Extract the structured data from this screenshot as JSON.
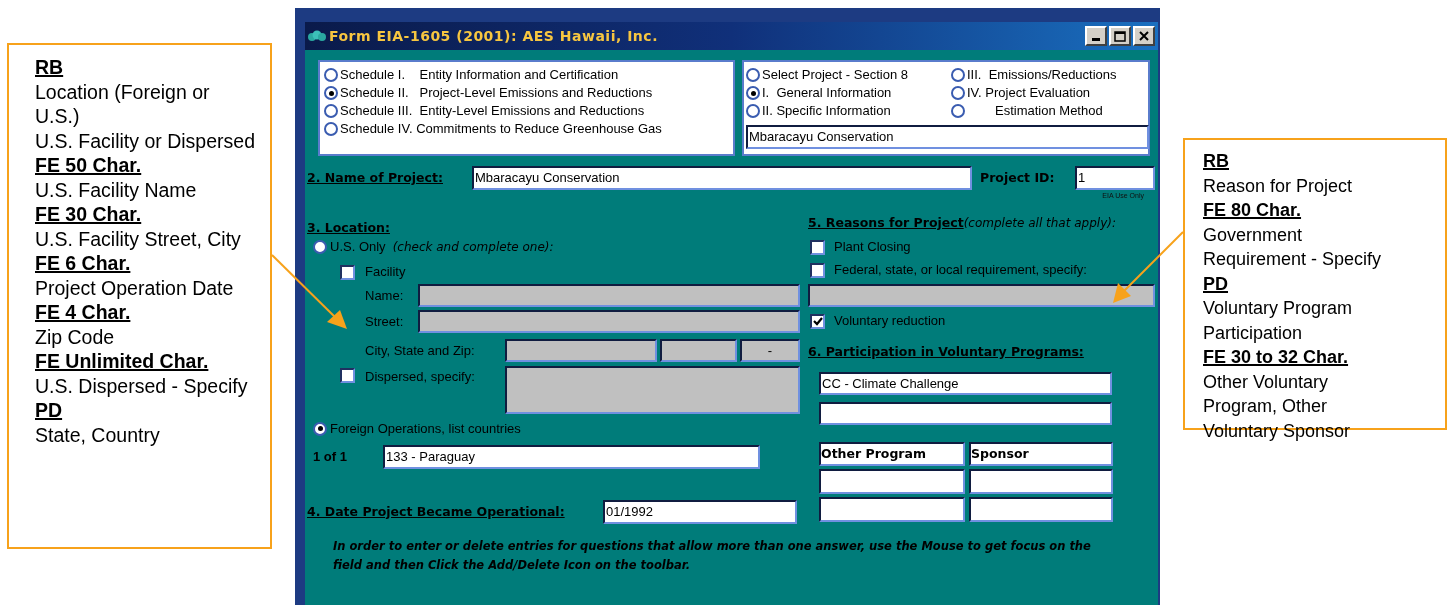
{
  "window": {
    "title": "Form EIA-1605 (2001): AES Hawaii, Inc."
  },
  "schedules": [
    {
      "label": "Schedule I.    Entity Information and Certification",
      "selected": false
    },
    {
      "label": "Schedule II.   Project-Level Emissions and Reductions",
      "selected": true
    },
    {
      "label": "Schedule III.  Entity-Level Emissions and Reductions",
      "selected": false
    },
    {
      "label": "Schedule IV. Commitments to Reduce Greenhouse Gas",
      "selected": false
    }
  ],
  "sections": [
    {
      "label": "Select Project - Section 8",
      "selected": false
    },
    {
      "label": "I.  General Information",
      "selected": true
    },
    {
      "label": "II. Specific Information",
      "selected": false
    },
    {
      "label": "III.  Emissions/Reductions",
      "selected": false
    },
    {
      "label": "IV. Project Evaluation",
      "selected": false
    },
    {
      "label": "Estimation Method",
      "selected": false
    }
  ],
  "section_project": {
    "value": "Mbaracayu Conservation"
  },
  "project_name": {
    "label": "2. Name of Project:",
    "value": "Mbaracayu Conservation"
  },
  "project_id": {
    "label": "Project ID:",
    "value": "1",
    "note": "EIA Use Only"
  },
  "location": {
    "heading": "3. Location:",
    "us_only": {
      "label": "U.S. Only",
      "hint": "(check and complete one):",
      "selected": false
    },
    "facility": {
      "label": "Facility",
      "checked": false
    },
    "name": {
      "label": "Name:",
      "disabled": true
    },
    "street": {
      "label": "Street:",
      "disabled": true
    },
    "city_state_zip": {
      "label": "City, State and Zip:",
      "fields": [
        {
          "disabled": true
        },
        {
          "disabled": true
        },
        {
          "value": "-",
          "disabled": true
        }
      ]
    },
    "dispersed": {
      "label": "Dispersed, specify:",
      "checked": false,
      "disabled": true
    },
    "foreign": {
      "label": "Foreign Operations, list countries",
      "selected": true
    },
    "country": {
      "counter": "1 of 1",
      "value": "133 - Paraguay"
    }
  },
  "date_operational": {
    "label": "4. Date Project Became Operational:",
    "value": "01/1992"
  },
  "reasons": {
    "heading": "5. Reasons for Project",
    "hint": "(complete all that apply):",
    "items": [
      {
        "kind": "checkbox",
        "label": "Plant Closing",
        "checked": false
      },
      {
        "kind": "checkbox",
        "label": "Federal, state, or local requirement, specify:",
        "checked": false
      },
      {
        "kind": "field",
        "disabled": true
      },
      {
        "kind": "checkbox",
        "label": "Voluntary reduction",
        "checked": true
      }
    ]
  },
  "voluntary_programs": {
    "heading": "6. Participation in Voluntary Programs:",
    "fields": [
      {
        "value": "CC - Climate Challenge",
        "disabled": false
      },
      {
        "disabled": false
      }
    ]
  },
  "other_programs": {
    "columns": [
      "Other Program",
      "Sponsor"
    ],
    "rows": [
      {
        "cells": [
          {
            "disabled": false
          },
          {
            "disabled": false
          }
        ]
      },
      {
        "cells": [
          {
            "disabled": false
          },
          {
            "disabled": false
          }
        ]
      }
    ]
  },
  "note": "In order to enter or delete entries for questions that allow more than one answer, use the Mouse to get focus on the field and then Click the Add/Delete Icon on the toolbar.",
  "callouts": {
    "left": {
      "items": [
        {
          "kind": "heading",
          "text": "RB"
        },
        {
          "kind": "text",
          "text": "Location (Foreign or U.S.)"
        },
        {
          "kind": "text",
          "text": "U.S. Facility or Dispersed"
        },
        {
          "kind": "heading",
          "text": "FE 50 Char."
        },
        {
          "kind": "text",
          "text": "U.S. Facility Name"
        },
        {
          "kind": "heading",
          "text": "FE 30 Char."
        },
        {
          "kind": "text",
          "text": "U.S. Facility Street, City"
        },
        {
          "kind": "heading",
          "text": "FE 6 Char."
        },
        {
          "kind": "text",
          "text": "Project Operation Date"
        },
        {
          "kind": "heading",
          "text": "FE 4 Char."
        },
        {
          "kind": "text",
          "text": "Zip Code"
        },
        {
          "kind": "heading",
          "text": "FE Unlimited Char."
        },
        {
          "kind": "text",
          "text": "U.S. Dispersed - Specify"
        },
        {
          "kind": "heading",
          "text": "PD"
        },
        {
          "kind": "text",
          "text": "State, Country"
        }
      ]
    },
    "right": {
      "items": [
        {
          "kind": "heading",
          "text": "RB"
        },
        {
          "kind": "text",
          "text": "Reason for Project"
        },
        {
          "kind": "heading",
          "text": "FE 80 Char."
        },
        {
          "kind": "text",
          "text": "Government Requirement  - Specify"
        },
        {
          "kind": "heading",
          "text": "PD"
        },
        {
          "kind": "text",
          "text": "Voluntary Program Participation"
        },
        {
          "kind": "heading",
          "text": "FE 30 to 32 Char."
        },
        {
          "kind": "text",
          "text": "Other Voluntary Program, Other Voluntary Sponsor"
        }
      ]
    }
  }
}
